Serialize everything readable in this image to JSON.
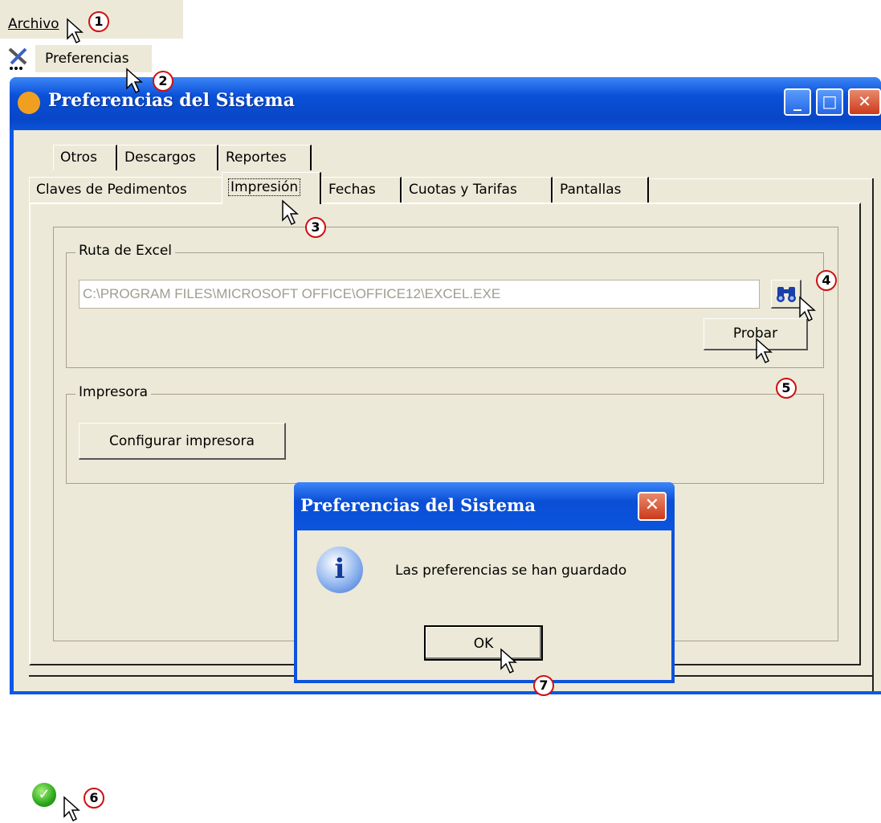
{
  "menu": {
    "archivo_label": "Archivo",
    "preferencias_label": "Preferencias"
  },
  "window": {
    "title": "Preferencias del Sistema",
    "buttons": {
      "minimize": "_",
      "maximize": "□",
      "close": "✕"
    }
  },
  "tabs": {
    "row_top": [
      {
        "label": "Otros"
      },
      {
        "label": "Descargos"
      },
      {
        "label": "Reportes"
      }
    ],
    "row_bottom": [
      {
        "label": "Claves de Pedimentos"
      },
      {
        "label": "Impresión",
        "selected": true
      },
      {
        "label": "Fechas"
      },
      {
        "label": "Cuotas y Tarifas"
      },
      {
        "label": "Pantallas"
      }
    ]
  },
  "excel_group": {
    "legend": "Ruta de Excel",
    "path_value": "C:\\PROGRAM FILES\\MICROSOFT OFFICE\\OFFICE12\\EXCEL.EXE",
    "browse_icon": "binoculars-icon",
    "probar_label": "Probar"
  },
  "printer_group": {
    "legend": "Impresora",
    "config_label": "Configurar impresora"
  },
  "dialog": {
    "title": "Preferencias del Sistema",
    "close": "✕",
    "icon": "info-icon",
    "message": "Las preferencias se han guardado",
    "ok_label": "OK"
  },
  "status": {
    "icon": "check-circle-icon"
  },
  "callouts": [
    "1",
    "2",
    "3",
    "4",
    "5",
    "6",
    "7"
  ],
  "colors": {
    "titlebar": "#0a50d8",
    "face": "#ece9d8",
    "callout_ring": "#d01010"
  }
}
